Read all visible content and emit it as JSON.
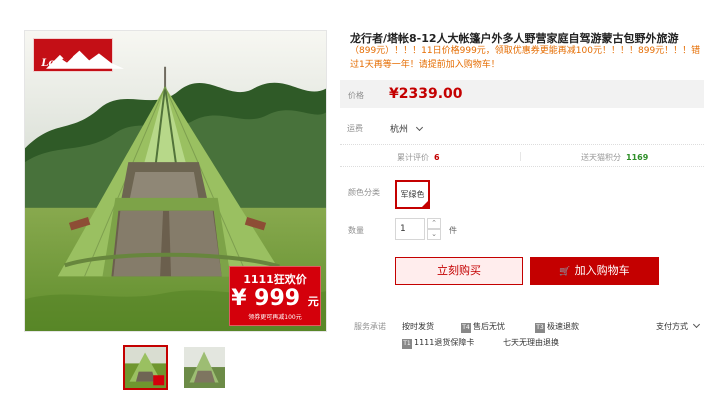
{
  "product": {
    "title": "龙行者/塔帐8-12人大帐篷户外多人野营家庭自驾游蒙古包野外旅游",
    "promotion": "（899元）！！！11日价格999元，领取优惠券更能再减100元！！！！899元！！！错过1天再等一年！请提前加入购物车！",
    "price_label": "价格",
    "price": "¥2339.00",
    "shipping_label": "运费",
    "shipping_value": "杭州",
    "review_label": "累计评价",
    "review_count": "6",
    "tmall_label": "送天猫积分",
    "tmall_points": "1169",
    "color_label": "颜色分类",
    "color_option": "军绿色",
    "quantity_label": "数量",
    "quantity_value": "1",
    "quantity_unit": "件",
    "buy_now": "立刻购买",
    "add_to_cart": "加入购物车"
  },
  "image": {
    "brand": "Longsinger",
    "promo_title": "1111狂欢价",
    "promo_price": "¥ 999",
    "promo_unit": "元",
    "promo_note": "领券更可再减100元"
  },
  "services": {
    "label": "服务承诺",
    "items": [
      "按时发货",
      "售后无忧",
      "极速退款",
      "1111退货保障卡",
      "七天无理由退换"
    ],
    "tags": [
      "T4",
      "T3",
      "T1"
    ],
    "pay_label": "支付方式"
  },
  "colors": {
    "accent": "#c40000",
    "tent_green": "#8bb24d",
    "tmall_green": "#2f8f29"
  },
  "icons": {
    "cart": "cart-icon",
    "quantity_up": "chevron-up-icon",
    "quantity_down": "chevron-down-icon",
    "dropdown": "chevron-down-icon",
    "check": "check-icon"
  }
}
